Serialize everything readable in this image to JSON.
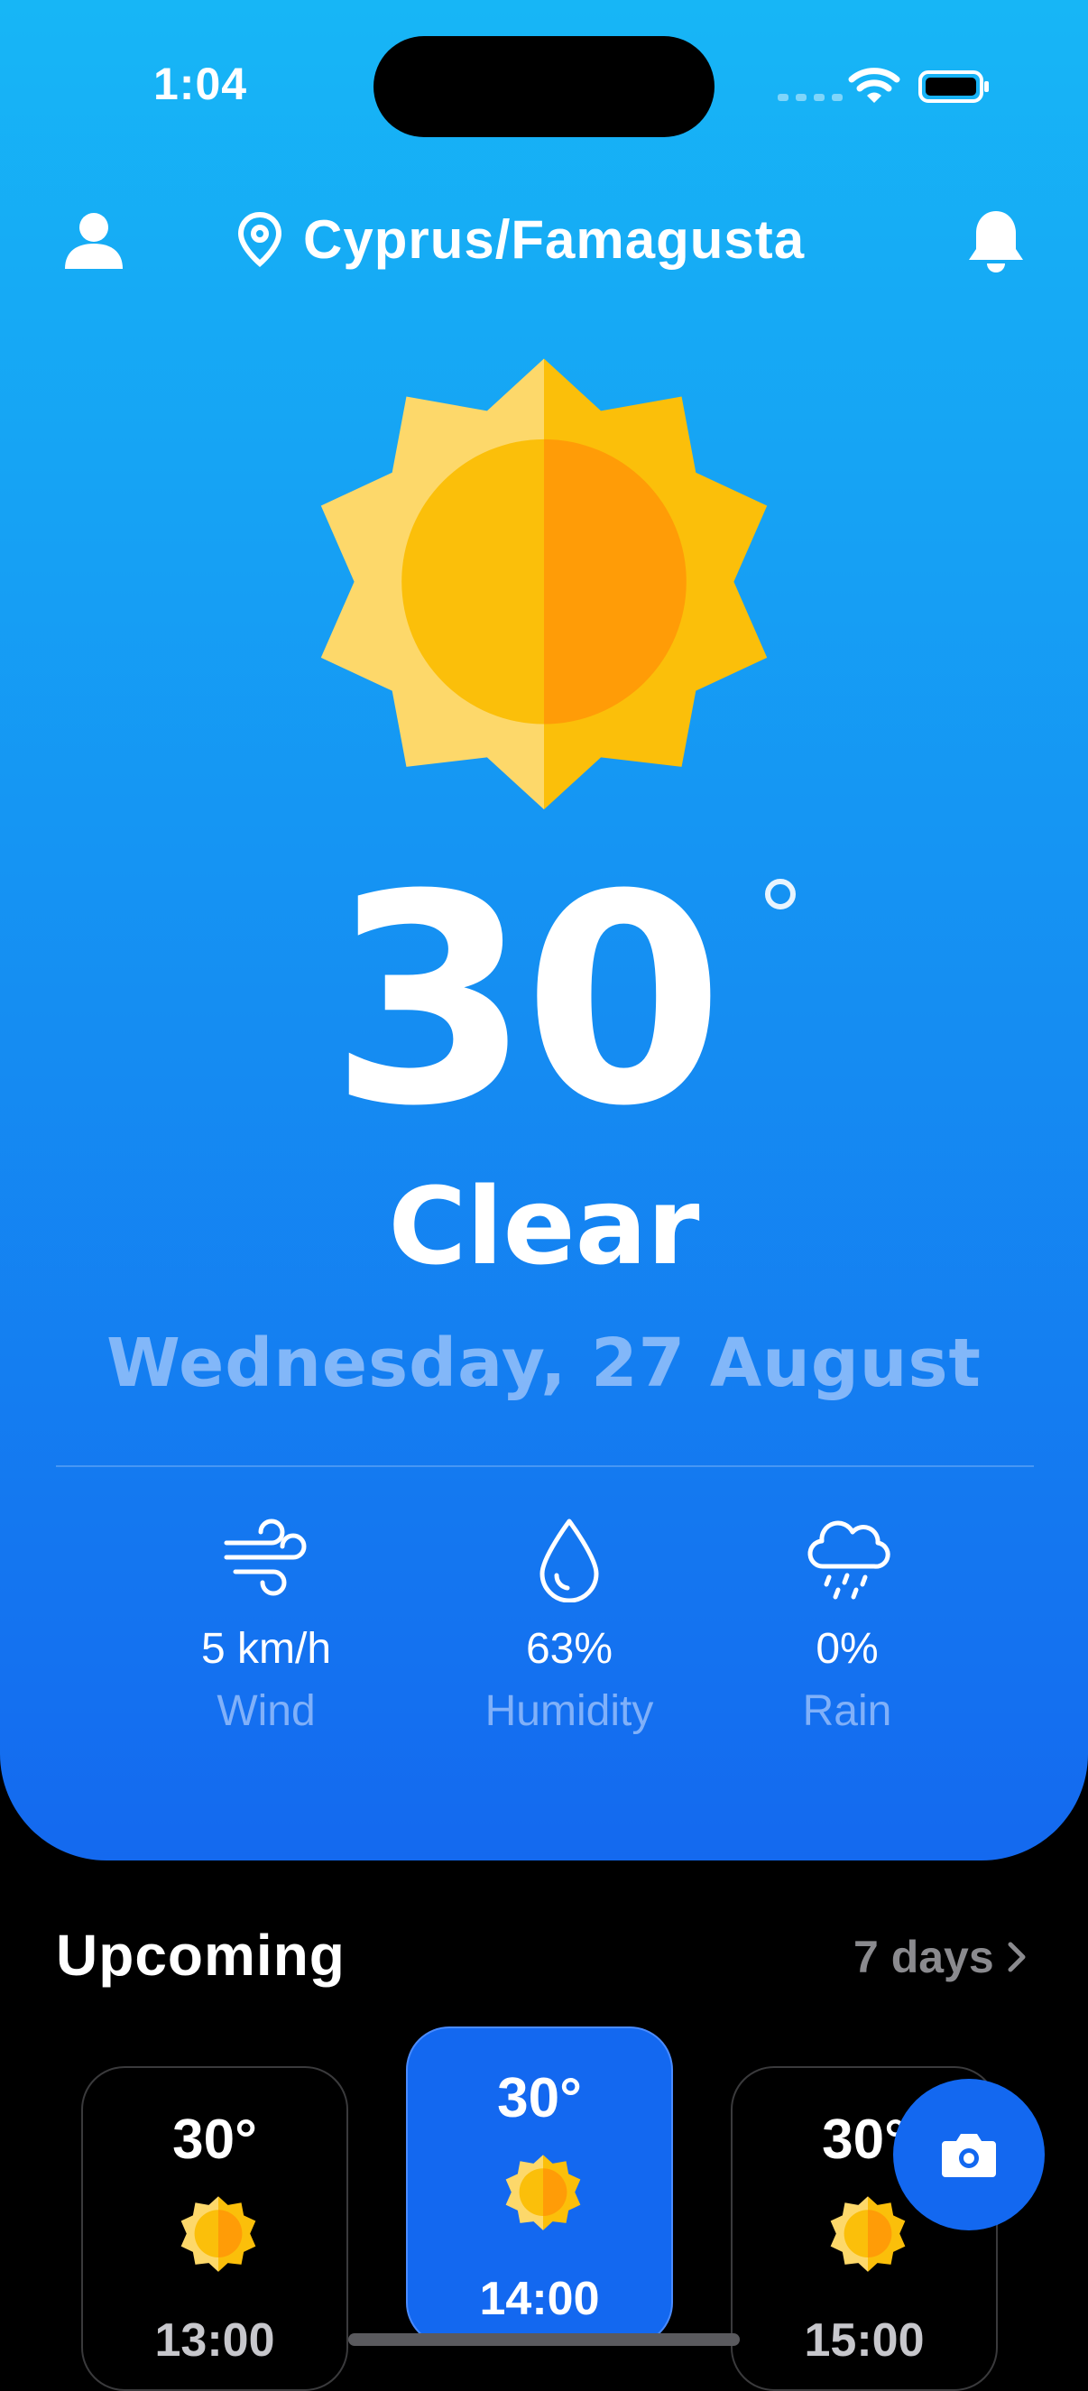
{
  "status_bar": {
    "time": "1:04"
  },
  "header": {
    "location": "Cyprus/Famagusta"
  },
  "current": {
    "temperature": "30",
    "condition": "Clear",
    "date": "Wednesday, 27 August"
  },
  "stats": [
    {
      "icon": "wind-icon",
      "value": "5 km/h",
      "label": "Wind"
    },
    {
      "icon": "droplet-icon",
      "value": "63%",
      "label": "Humidity"
    },
    {
      "icon": "rain-cloud-icon",
      "value": "0%",
      "label": "Rain"
    }
  ],
  "upcoming": {
    "title": "Upcoming",
    "link_label": "7 days",
    "hours": [
      {
        "temp": "30°",
        "time": "13:00",
        "active": false
      },
      {
        "temp": "30°",
        "time": "14:00",
        "active": true
      },
      {
        "temp": "30°",
        "time": "15:00",
        "active": false
      }
    ]
  },
  "colors": {
    "hero_top": "#17b6f6",
    "hero_bottom": "#1469ef",
    "accent": "#1368f0",
    "sun_light": "#fdd86a",
    "sun_dark": "#fbbf0a",
    "sun_core": "#ff9c07"
  }
}
